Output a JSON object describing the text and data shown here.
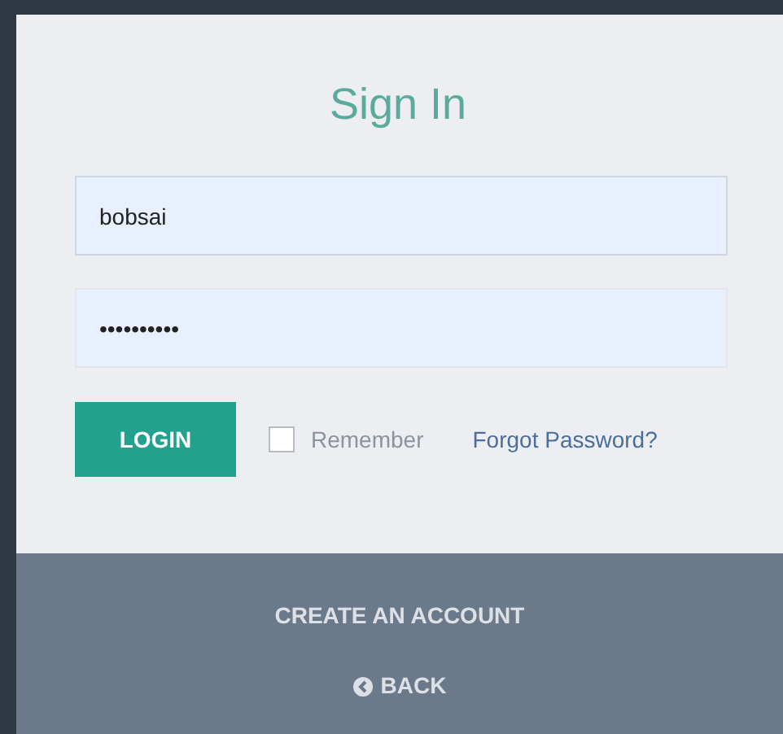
{
  "title": "Sign In",
  "username": {
    "value": "bobsai"
  },
  "password": {
    "value": "••••••••••"
  },
  "login_button": "LOGIN",
  "remember": {
    "label": "Remember",
    "checked": false
  },
  "forgot_link": "Forgot Password?",
  "footer": {
    "create_account": "CREATE AN ACCOUNT",
    "back": "BACK"
  }
}
